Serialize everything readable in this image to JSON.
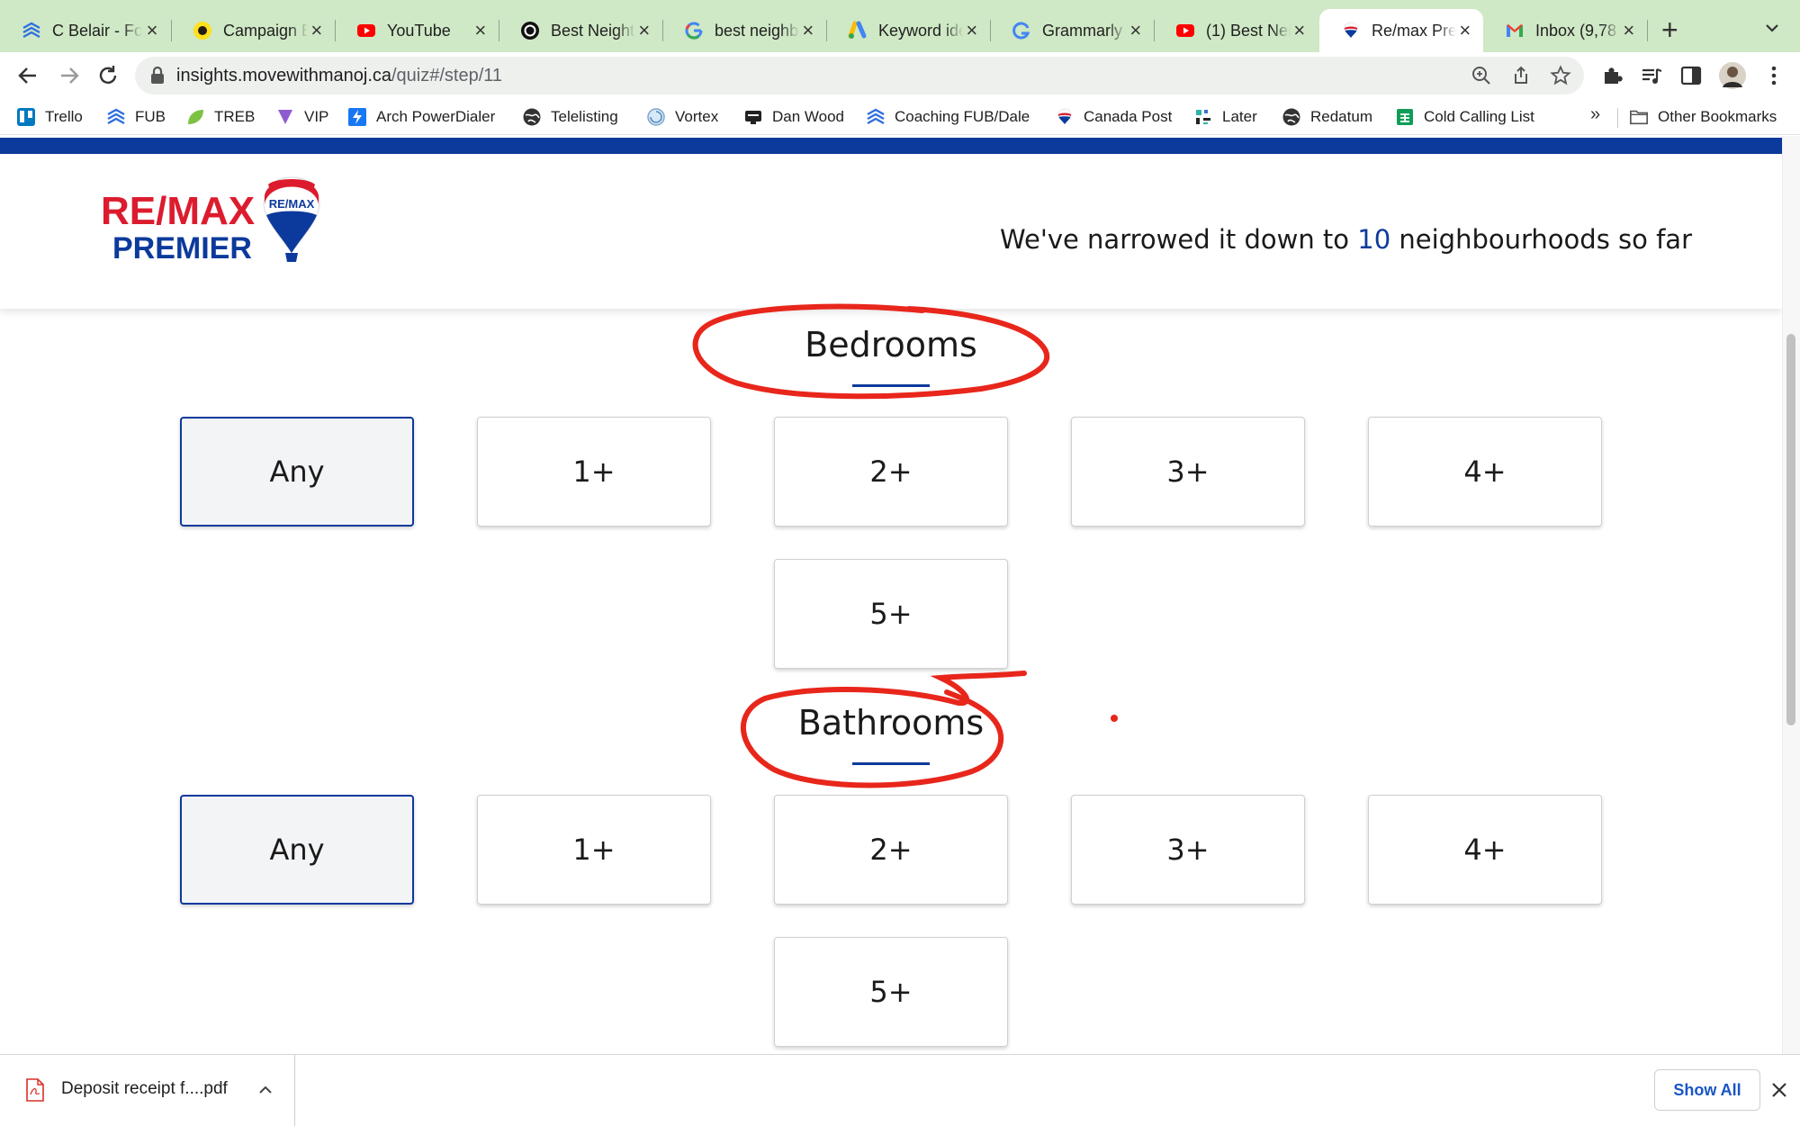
{
  "tabs": [
    {
      "title": "C Belair - Fo",
      "icon": "fub-icon"
    },
    {
      "title": "Campaign E",
      "icon": "mailchimp-icon"
    },
    {
      "title": "YouTube",
      "icon": "youtube-icon"
    },
    {
      "title": "Best Neight",
      "icon": "chatgpt-icon"
    },
    {
      "title": "best neighb",
      "icon": "google-icon"
    },
    {
      "title": "Keyword ide",
      "icon": "google-ads-icon"
    },
    {
      "title": "Grammarly",
      "icon": "grammarly-icon"
    },
    {
      "title": "(1) Best Nei",
      "icon": "youtube-icon"
    },
    {
      "title": "Re/max Prer",
      "icon": "remax-balloon-icon",
      "active": true
    },
    {
      "title": "Inbox (9,78",
      "icon": "gmail-icon"
    }
  ],
  "new_tab_label": "+",
  "address_bar": {
    "domain": "insights.movewithmanoj.ca",
    "path": "/quiz#/step/11"
  },
  "bookmarks": [
    {
      "label": "Trello",
      "icon": "trello-icon"
    },
    {
      "label": "FUB",
      "icon": "fub-icon"
    },
    {
      "label": "TREB",
      "icon": "leaf-icon"
    },
    {
      "label": "VIP",
      "icon": "vip-icon"
    },
    {
      "label": "Arch PowerDialer",
      "icon": "powerdialer-icon"
    },
    {
      "label": "Telelisting",
      "icon": "globe-icon"
    },
    {
      "label": "Vortex",
      "icon": "vortex-icon"
    },
    {
      "label": "Dan Wood",
      "icon": "dan-wood-icon"
    },
    {
      "label": "Coaching FUB/Dale",
      "icon": "fub-icon"
    },
    {
      "label": "Canada Post",
      "icon": "remax-balloon-icon"
    },
    {
      "label": "Later",
      "icon": "later-icon"
    },
    {
      "label": "Redatum",
      "icon": "globe-icon"
    },
    {
      "label": "Cold Calling List",
      "icon": "sheets-icon"
    }
  ],
  "bookmarks_overflow": "»",
  "other_bookmarks": "Other Bookmarks",
  "site": {
    "logo_text_line1": "RE/MAX",
    "logo_text_line2": "PREMIER",
    "logo_balloon_text": "RE/MAX",
    "narrowed_prefix": "We've narrowed it down to ",
    "narrowed_count": "10",
    "narrowed_suffix": " neighbourhoods so far"
  },
  "bedrooms": {
    "title": "Bedrooms",
    "options": [
      "Any",
      "1+",
      "2+",
      "3+",
      "4+",
      "5+"
    ],
    "selected": "Any"
  },
  "bathrooms": {
    "title": "Bathrooms",
    "options": [
      "Any",
      "1+",
      "2+",
      "3+",
      "4+",
      "5+"
    ],
    "selected": "Any"
  },
  "download_shelf": {
    "file_name": "Deposit receipt f....pdf",
    "show_all": "Show All"
  },
  "colors": {
    "brand_blue": "#0c3a9c",
    "remax_red": "#dc1c2e",
    "annotation_red": "#e8261b",
    "tab_strip": "#cfe8c5"
  }
}
